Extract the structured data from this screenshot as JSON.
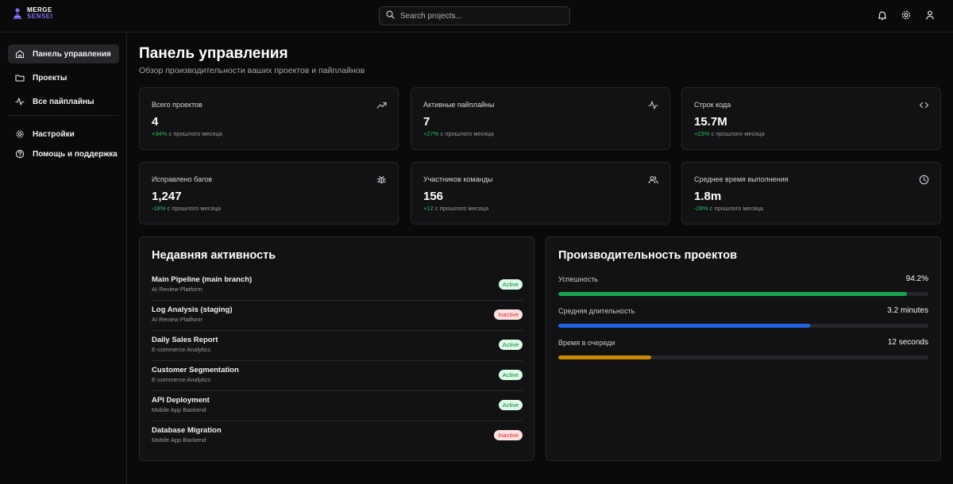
{
  "app": {
    "logo_line1": "MERGE",
    "logo_line2": "SENSEI"
  },
  "search": {
    "placeholder": "Search projects..."
  },
  "top_icons": [
    "bell-icon",
    "gear-icon",
    "user-icon"
  ],
  "sidebar": {
    "items": [
      {
        "label": "Панель управления",
        "icon": "home-icon",
        "active": true
      },
      {
        "label": "Проекты",
        "icon": "folder-icon",
        "active": false
      },
      {
        "label": "Все пайплайны",
        "icon": "activity-icon",
        "active": false
      },
      {
        "label": "Настройки",
        "icon": "gear-icon",
        "active": false
      },
      {
        "label": "Помощь и поддержка",
        "icon": "help-circle-icon",
        "active": false
      }
    ]
  },
  "header": {
    "title": "Панель управления",
    "subtitle": "Обзор производительности ваших проектов и пайплайнов"
  },
  "stats": [
    {
      "label": "Всего проектов",
      "value": "4",
      "change": "+34%",
      "change_suffix": "с прошлого месяца",
      "icon": "trending-up-icon"
    },
    {
      "label": "Активные пайплайны",
      "value": "7",
      "change": "+27%",
      "change_suffix": "с прошлого месяца",
      "icon": "activity-icon"
    },
    {
      "label": "Строк кода",
      "value": "15.7M",
      "change": "+23%",
      "change_suffix": "с прошлого месяца",
      "icon": "code-icon"
    },
    {
      "label": "Исправлено багов",
      "value": "1,247",
      "change": "-18%",
      "change_suffix": "с прошлого месяца",
      "icon": "bug-icon"
    },
    {
      "label": "Участников команды",
      "value": "156",
      "change": "+12",
      "change_suffix": "с прошлого месяца",
      "icon": "users-icon"
    },
    {
      "label": "Среднее время выполнения",
      "value": "1.8m",
      "change": "-28%",
      "change_suffix": "с прошлого месяца",
      "icon": "clock-icon"
    }
  ],
  "activity": {
    "title": "Недавняя активность",
    "rows": [
      {
        "name": "Main Pipeline (main branch)",
        "project": "AI Review Platform",
        "status": "Active"
      },
      {
        "name": "Log Analysis (staging)",
        "project": "AI Review Platform",
        "status": "Inactive"
      },
      {
        "name": "Daily Sales Report",
        "project": "E-commerce Analytics",
        "status": "Active"
      },
      {
        "name": "Customer Segmentation",
        "project": "E-commerce Analytics",
        "status": "Active"
      },
      {
        "name": "API Deployment",
        "project": "Mobile App Backend",
        "status": "Active"
      },
      {
        "name": "Database Migration",
        "project": "Mobile App Backend",
        "status": "Inactive"
      }
    ]
  },
  "performance": {
    "title": "Производительность проектов",
    "metrics": [
      {
        "label": "Успешность",
        "value": "94.2%",
        "fraction": 0.942,
        "color": "#16a34a"
      },
      {
        "label": "Средняя длительность",
        "value": "3.2 minutes",
        "fraction": 0.68,
        "color": "#2563eb"
      },
      {
        "label": "Время в очереди",
        "value": "12 seconds",
        "fraction": 0.25,
        "color": "#ca8a04"
      }
    ]
  },
  "colors": {
    "accent": "#7b6cf0",
    "positive": "#22c55e",
    "active_badge_bg": "#dcfce7",
    "inactive_badge_bg": "#fee2e2"
  }
}
